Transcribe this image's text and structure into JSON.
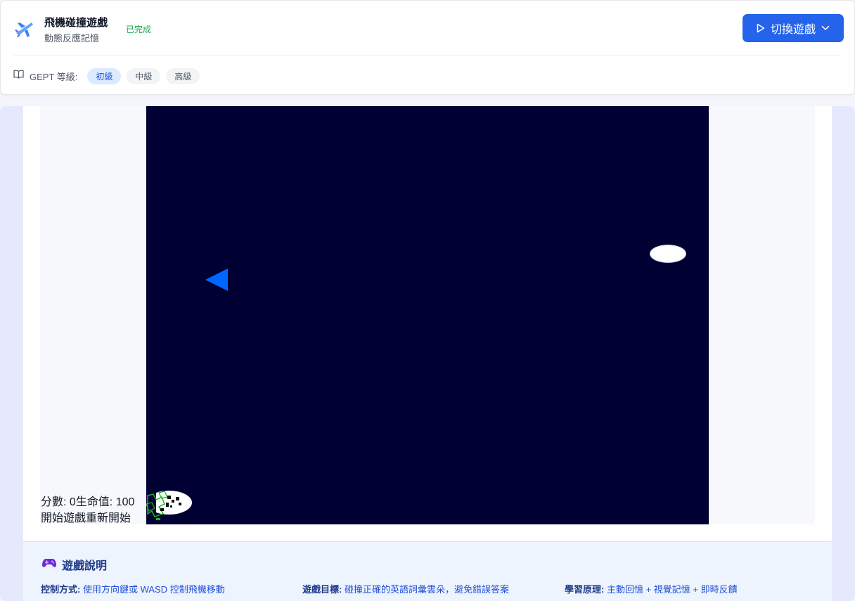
{
  "header": {
    "title": "飛機碰撞遊戲",
    "subtitle": "動態反應記憶",
    "status": "已完成",
    "switch_label": "切換遊戲",
    "level_label": "GEPT 等級:",
    "levels": [
      "初級",
      "中級",
      "高級"
    ],
    "active_level": "初級"
  },
  "game": {
    "score_text": "分數: 0",
    "life_text": "生命值: 100",
    "start_label": "開始遊戲",
    "restart_label": "重新開始",
    "canvas_bg": "#000033",
    "player_color": "#0066ff"
  },
  "info": {
    "icon": "gamepad-icon",
    "title": "遊戲說明",
    "control_label": "控制方式:",
    "control_text": "使用方向鍵或 WASD 控制飛機移動",
    "goal_label": "遊戲目標:",
    "goal_text": "碰撞正確的英語詞彙雲朵，避免錯誤答案",
    "principle_label": "學習原理:",
    "principle_text": "主動回憶 + 視覺記憶 + 即時反饋"
  },
  "colors": {
    "accent": "#2563eb",
    "status_green": "#16a34a"
  }
}
